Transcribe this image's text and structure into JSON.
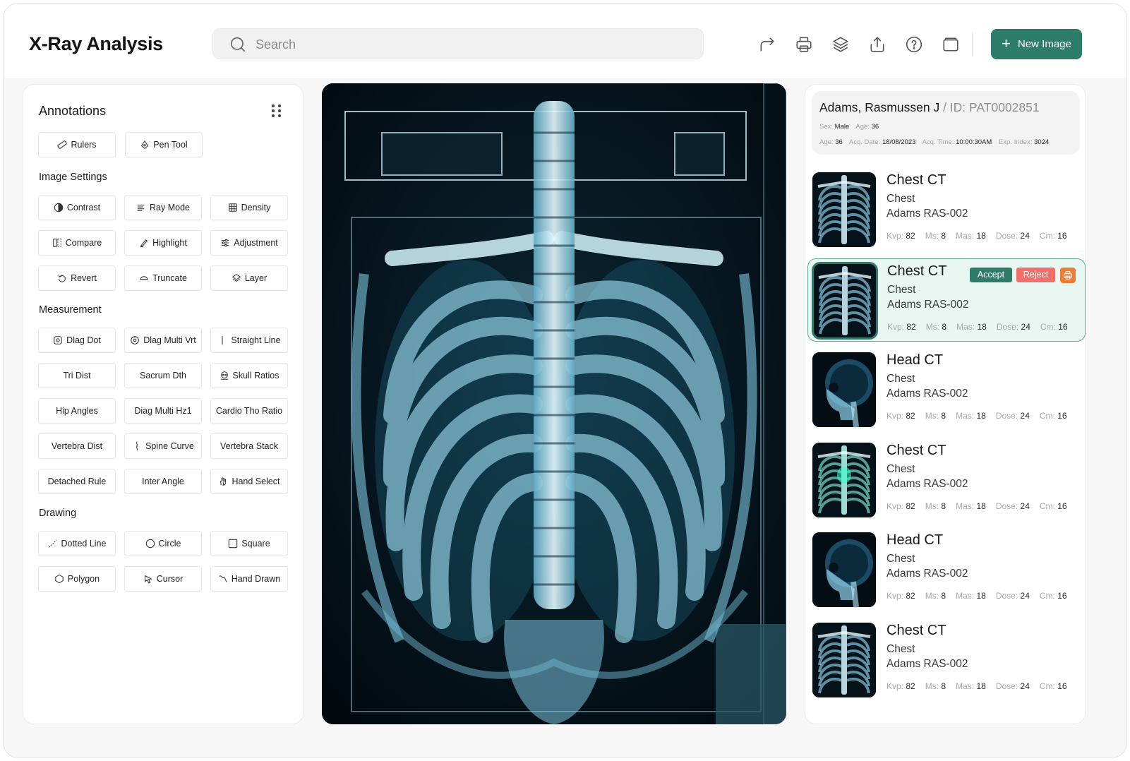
{
  "app": {
    "title": "X-Ray Analysis"
  },
  "search": {
    "placeholder": "Search"
  },
  "toolbar": {
    "icons": [
      "redo-icon",
      "print-icon",
      "layers-icon",
      "share-icon",
      "help-icon",
      "folder-icon"
    ],
    "new_image_label": "New Image",
    "accent": "#2e7d6b"
  },
  "annotations": {
    "title": "Annotations",
    "tools": [
      {
        "label": "Rulers",
        "icon": "ruler-icon"
      },
      {
        "label": "Pen Tool",
        "icon": "pen-tool-icon"
      }
    ]
  },
  "image_settings": {
    "title": "Image Settings",
    "tools": [
      {
        "label": "Contrast",
        "icon": "contrast-icon"
      },
      {
        "label": "Ray Mode",
        "icon": "ray-mode-icon"
      },
      {
        "label": "Density",
        "icon": "density-icon"
      },
      {
        "label": "Compare",
        "icon": "compare-icon"
      },
      {
        "label": "Highlight",
        "icon": "highlight-icon"
      },
      {
        "label": "Adjustment",
        "icon": "adjustment-icon"
      },
      {
        "label": "Revert",
        "icon": "revert-icon"
      },
      {
        "label": "Truncate",
        "icon": "truncate-icon"
      },
      {
        "label": "Layer",
        "icon": "layer-icon"
      }
    ]
  },
  "measurement": {
    "title": "Measurement",
    "tools": [
      {
        "label": "Dlag Dot",
        "icon": "dot-icon"
      },
      {
        "label": "Dlag Multi Vrt",
        "icon": "multi-vertical-icon"
      },
      {
        "label": "Straight Line",
        "icon": "straight-line-icon"
      },
      {
        "label": "Tri Dist"
      },
      {
        "label": "Sacrum Dth"
      },
      {
        "label": "Skull Ratios",
        "icon": "skull-ratios-icon"
      },
      {
        "label": "Hip Angles"
      },
      {
        "label": "Diag Multi Hz1"
      },
      {
        "label": "Cardio Tho Ratio"
      },
      {
        "label": "Vertebra Dist"
      },
      {
        "label": "Spine Curve",
        "icon": "spine-icon"
      },
      {
        "label": "Vertebra Stack"
      },
      {
        "label": "Detached Rule"
      },
      {
        "label": "Inter Angle"
      },
      {
        "label": "Hand Select",
        "icon": "hand-icon"
      }
    ]
  },
  "drawing": {
    "title": "Drawing",
    "tools": [
      {
        "label": "Dotted Line",
        "icon": "dotted-line-icon"
      },
      {
        "label": "Circle",
        "icon": "circle-icon"
      },
      {
        "label": "Square",
        "icon": "square-icon"
      },
      {
        "label": "Polygon",
        "icon": "polygon-icon"
      },
      {
        "label": "Cursor",
        "icon": "cursor-icon"
      },
      {
        "label": "Hand Drawn",
        "icon": "hand-drawn-icon"
      }
    ]
  },
  "patient": {
    "name": "Adams, Rasmussen J",
    "id_text": "/ ID: PAT0002851",
    "row1": [
      {
        "k": "Sex:",
        "v": "Male"
      },
      {
        "k": "Age:",
        "v": "36"
      }
    ],
    "row2": [
      {
        "k": "Age:",
        "v": "36"
      },
      {
        "k": "Acq. Date:",
        "v": "18/08/2023"
      },
      {
        "k": "Acq. Time:",
        "v": "10:00:30AM"
      },
      {
        "k": "Exp. Index:",
        "v": "3024"
      }
    ]
  },
  "scans": [
    {
      "title": "Chest CT",
      "region": "Chest",
      "patient": "Adams RAS-002",
      "kind": "chest",
      "kvp": "82",
      "ms": "8",
      "mas": "18",
      "dose": "24",
      "cm": "16"
    },
    {
      "title": "Chest CT",
      "region": "Chest",
      "patient": "Adams RAS-002",
      "kind": "chest2",
      "kvp": "82",
      "ms": "8",
      "mas": "18",
      "dose": "24",
      "cm": "16",
      "selected": true,
      "accept": "Accept",
      "reject": "Reject"
    },
    {
      "title": "Head CT",
      "region": "Chest",
      "patient": "Adams RAS-002",
      "kind": "head",
      "kvp": "82",
      "ms": "8",
      "mas": "18",
      "dose": "24",
      "cm": "16"
    },
    {
      "title": "Chest CT",
      "region": "Chest",
      "patient": "Adams RAS-002",
      "kind": "chest3",
      "kvp": "82",
      "ms": "8",
      "mas": "18",
      "dose": "24",
      "cm": "16"
    },
    {
      "title": "Head CT",
      "region": "Chest",
      "patient": "Adams RAS-002",
      "kind": "head",
      "kvp": "82",
      "ms": "8",
      "mas": "18",
      "dose": "24",
      "cm": "16"
    },
    {
      "title": "Chest CT",
      "region": "Chest",
      "patient": "Adams RAS-002",
      "kind": "chest",
      "kvp": "82",
      "ms": "8",
      "mas": "18",
      "dose": "24",
      "cm": "16"
    }
  ],
  "stat_labels": {
    "kvp": "Kvp:",
    "ms": "Ms:",
    "mas": "Mas:",
    "dose": "Dose:",
    "cm": "Cm:"
  }
}
